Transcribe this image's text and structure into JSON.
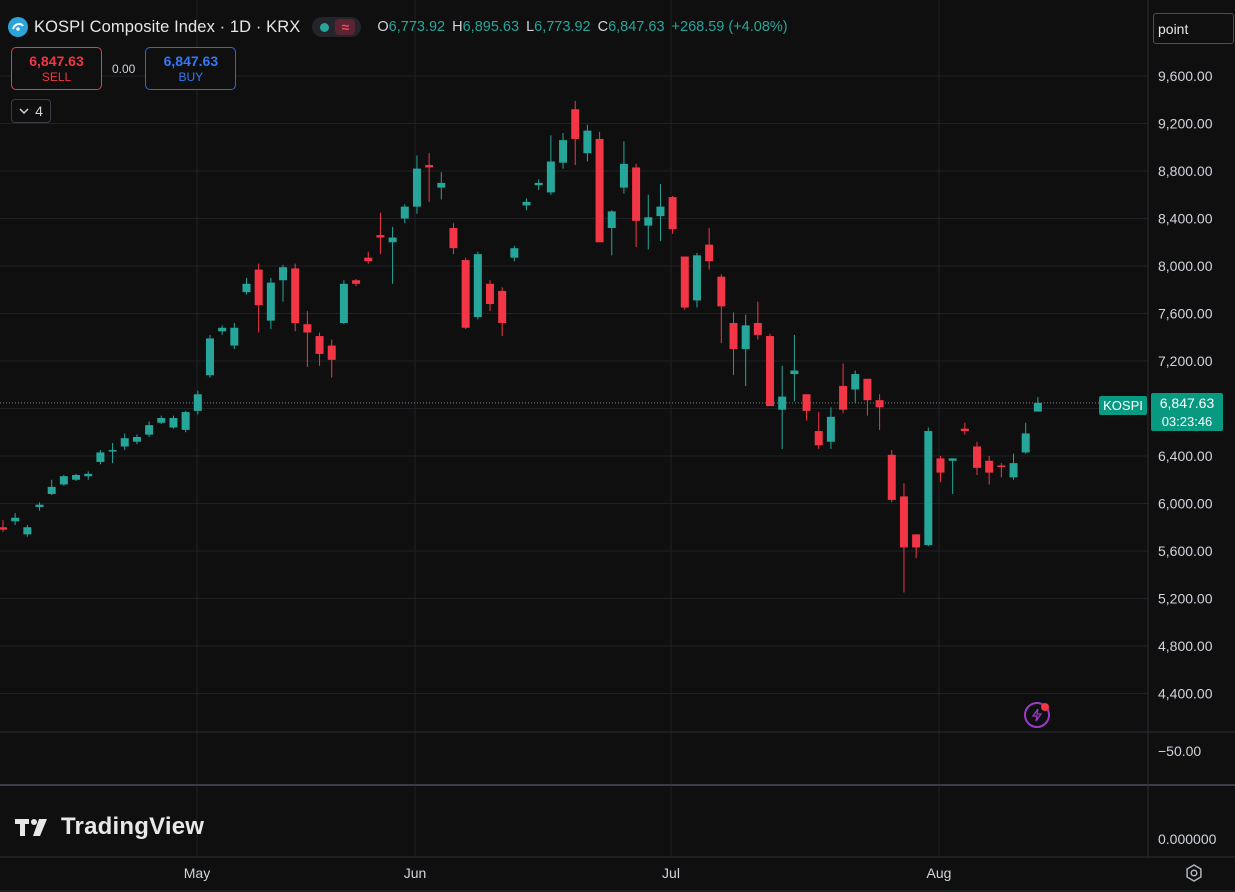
{
  "header": {
    "title": "KOSPI Composite Index · 1D · KRX",
    "status_wave": "≈",
    "ohlc": [
      {
        "label": "O",
        "value": "6,773.92"
      },
      {
        "label": "H",
        "value": "6,895.63"
      },
      {
        "label": "L",
        "value": "6,773.92"
      },
      {
        "label": "C",
        "value": "6,847.63"
      }
    ],
    "change": "+268.59 (+4.08%)"
  },
  "trade": {
    "sell_price": "6,847.63",
    "sell_label": "SELL",
    "spread": "0.00",
    "buy_price": "6,847.63",
    "buy_label": "BUY"
  },
  "indicators_toggle": {
    "count": "4"
  },
  "scale_mode": {
    "label": "point"
  },
  "last_price": {
    "symbol": "KOSPI",
    "price": "6,847.63",
    "countdown": "03:23:46"
  },
  "brand": {
    "name": "TradingView"
  },
  "colors": {
    "up": "#26a69a",
    "down": "#f23645",
    "background": "#0f0f0f",
    "grid": "#1f2125",
    "text": "#d1d4dc"
  },
  "chart_data": {
    "type": "candlestick",
    "interval": "1D",
    "x_labels": [
      "May",
      "Jun",
      "Jul",
      "Aug"
    ],
    "y_ticks": [
      "9,600.00",
      "9,200.00",
      "8,800.00",
      "8,400.00",
      "8,000.00",
      "7,600.00",
      "7,200.00",
      "6,800.00",
      "6,400.00",
      "6,000.00",
      "5,600.00",
      "5,200.00",
      "4,800.00",
      "4,400.00"
    ],
    "y_range": [
      4100,
      9850
    ],
    "last_value": 6847.63,
    "sub_panes": [
      {
        "tick": "−50.00"
      },
      {
        "tick": "0.000000"
      }
    ],
    "candles": [
      {
        "o": 5800,
        "h": 5860,
        "l": 5760,
        "c": 5780
      },
      {
        "o": 5850,
        "h": 5920,
        "l": 5820,
        "c": 5880
      },
      {
        "o": 5740,
        "h": 5820,
        "l": 5720,
        "c": 5800
      },
      {
        "o": 5970,
        "h": 6010,
        "l": 5940,
        "c": 5990
      },
      {
        "o": 6080,
        "h": 6200,
        "l": 6070,
        "c": 6140
      },
      {
        "o": 6160,
        "h": 6240,
        "l": 6150,
        "c": 6230
      },
      {
        "o": 6200,
        "h": 6250,
        "l": 6190,
        "c": 6240
      },
      {
        "o": 6230,
        "h": 6270,
        "l": 6200,
        "c": 6250
      },
      {
        "o": 6350,
        "h": 6450,
        "l": 6330,
        "c": 6430
      },
      {
        "o": 6440,
        "h": 6510,
        "l": 6340,
        "c": 6450
      },
      {
        "o": 6480,
        "h": 6590,
        "l": 6450,
        "c": 6550
      },
      {
        "o": 6520,
        "h": 6580,
        "l": 6500,
        "c": 6560
      },
      {
        "o": 6580,
        "h": 6690,
        "l": 6560,
        "c": 6660
      },
      {
        "o": 6680,
        "h": 6740,
        "l": 6670,
        "c": 6720
      },
      {
        "o": 6640,
        "h": 6740,
        "l": 6630,
        "c": 6720
      },
      {
        "o": 6620,
        "h": 6780,
        "l": 6600,
        "c": 6770
      },
      {
        "o": 6780,
        "h": 6950,
        "l": 6750,
        "c": 6920
      },
      {
        "o": 7080,
        "h": 7420,
        "l": 7060,
        "c": 7390
      },
      {
        "o": 7450,
        "h": 7500,
        "l": 7420,
        "c": 7480
      },
      {
        "o": 7330,
        "h": 7520,
        "l": 7300,
        "c": 7480
      },
      {
        "o": 7780,
        "h": 7900,
        "l": 7760,
        "c": 7850
      },
      {
        "o": 7970,
        "h": 8020,
        "l": 7440,
        "c": 7670
      },
      {
        "o": 7540,
        "h": 7900,
        "l": 7470,
        "c": 7860
      },
      {
        "o": 7880,
        "h": 8010,
        "l": 7700,
        "c": 7990
      },
      {
        "o": 7980,
        "h": 8020,
        "l": 7450,
        "c": 7520
      },
      {
        "o": 7510,
        "h": 7620,
        "l": 7150,
        "c": 7440
      },
      {
        "o": 7410,
        "h": 7440,
        "l": 7160,
        "c": 7260
      },
      {
        "o": 7330,
        "h": 7380,
        "l": 7060,
        "c": 7210
      },
      {
        "o": 7520,
        "h": 7880,
        "l": 7510,
        "c": 7850
      },
      {
        "o": 7880,
        "h": 7890,
        "l": 7830,
        "c": 7850
      },
      {
        "o": 8070,
        "h": 8120,
        "l": 8020,
        "c": 8040
      },
      {
        "o": 8260,
        "h": 8450,
        "l": 8100,
        "c": 8240
      },
      {
        "o": 8200,
        "h": 8330,
        "l": 7850,
        "c": 8240
      },
      {
        "o": 8400,
        "h": 8520,
        "l": 8360,
        "c": 8500
      },
      {
        "o": 8500,
        "h": 8930,
        "l": 8440,
        "c": 8820
      },
      {
        "o": 8850,
        "h": 8950,
        "l": 8540,
        "c": 8830
      },
      {
        "o": 8660,
        "h": 8790,
        "l": 8560,
        "c": 8700
      },
      {
        "o": 8320,
        "h": 8360,
        "l": 8100,
        "c": 8150
      },
      {
        "o": 8050,
        "h": 8070,
        "l": 7470,
        "c": 7480
      },
      {
        "o": 7570,
        "h": 8120,
        "l": 7550,
        "c": 8100
      },
      {
        "o": 7850,
        "h": 7880,
        "l": 7620,
        "c": 7680
      },
      {
        "o": 7790,
        "h": 7820,
        "l": 7410,
        "c": 7520
      },
      {
        "o": 8070,
        "h": 8170,
        "l": 8040,
        "c": 8150
      },
      {
        "o": 8510,
        "h": 8570,
        "l": 8470,
        "c": 8540
      },
      {
        "o": 8680,
        "h": 8730,
        "l": 8640,
        "c": 8700
      },
      {
        "o": 8620,
        "h": 9100,
        "l": 8600,
        "c": 8880
      },
      {
        "o": 8870,
        "h": 9120,
        "l": 8820,
        "c": 9060
      },
      {
        "o": 9320,
        "h": 9390,
        "l": 8850,
        "c": 9070
      },
      {
        "o": 8950,
        "h": 9190,
        "l": 8880,
        "c": 9140
      },
      {
        "o": 9070,
        "h": 9130,
        "l": 8220,
        "c": 8200
      },
      {
        "o": 8320,
        "h": 8470,
        "l": 8090,
        "c": 8460
      },
      {
        "o": 8660,
        "h": 9050,
        "l": 8610,
        "c": 8860
      },
      {
        "o": 8830,
        "h": 8860,
        "l": 8160,
        "c": 8380
      },
      {
        "o": 8340,
        "h": 8600,
        "l": 8140,
        "c": 8410
      },
      {
        "o": 8420,
        "h": 8690,
        "l": 8210,
        "c": 8500
      },
      {
        "o": 8580,
        "h": 8590,
        "l": 8270,
        "c": 8310
      },
      {
        "o": 8080,
        "h": 8080,
        "l": 7630,
        "c": 7650
      },
      {
        "o": 7710,
        "h": 8110,
        "l": 7650,
        "c": 8090
      },
      {
        "o": 8180,
        "h": 8320,
        "l": 7970,
        "c": 8040
      },
      {
        "o": 7910,
        "h": 7930,
        "l": 7350,
        "c": 7660
      },
      {
        "o": 7520,
        "h": 7610,
        "l": 7080,
        "c": 7300
      },
      {
        "o": 7300,
        "h": 7590,
        "l": 6990,
        "c": 7500
      },
      {
        "o": 7520,
        "h": 7700,
        "l": 7380,
        "c": 7420
      },
      {
        "o": 7410,
        "h": 7430,
        "l": 6830,
        "c": 6820
      },
      {
        "o": 6790,
        "h": 7160,
        "l": 6460,
        "c": 6900
      },
      {
        "o": 7090,
        "h": 7420,
        "l": 6860,
        "c": 7120
      },
      {
        "o": 6920,
        "h": 6920,
        "l": 6700,
        "c": 6780
      },
      {
        "o": 6610,
        "h": 6770,
        "l": 6460,
        "c": 6490
      },
      {
        "o": 6520,
        "h": 6810,
        "l": 6460,
        "c": 6730
      },
      {
        "o": 6990,
        "h": 7180,
        "l": 6760,
        "c": 6790
      },
      {
        "o": 6960,
        "h": 7120,
        "l": 6850,
        "c": 7090
      },
      {
        "o": 7050,
        "h": 7050,
        "l": 6740,
        "c": 6870
      },
      {
        "o": 6870,
        "h": 6920,
        "l": 6620,
        "c": 6810
      },
      {
        "o": 6410,
        "h": 6450,
        "l": 6010,
        "c": 6030
      },
      {
        "o": 6060,
        "h": 6170,
        "l": 5250,
        "c": 5630
      },
      {
        "o": 5740,
        "h": 5740,
        "l": 5540,
        "c": 5630
      },
      {
        "o": 5650,
        "h": 6640,
        "l": 5640,
        "c": 6610
      },
      {
        "o": 6380,
        "h": 6400,
        "l": 6180,
        "c": 6260
      },
      {
        "o": 6360,
        "h": 6380,
        "l": 6080,
        "c": 6380
      },
      {
        "o": 6630,
        "h": 6680,
        "l": 6580,
        "c": 6610
      },
      {
        "o": 6480,
        "h": 6520,
        "l": 6240,
        "c": 6300
      },
      {
        "o": 6360,
        "h": 6400,
        "l": 6160,
        "c": 6260
      },
      {
        "o": 6320,
        "h": 6340,
        "l": 6220,
        "c": 6310
      },
      {
        "o": 6220,
        "h": 6420,
        "l": 6200,
        "c": 6340
      },
      {
        "o": 6430,
        "h": 6680,
        "l": 6420,
        "c": 6590
      },
      {
        "o": 6773.92,
        "h": 6895.63,
        "l": 6773.92,
        "c": 6847.63
      }
    ]
  }
}
